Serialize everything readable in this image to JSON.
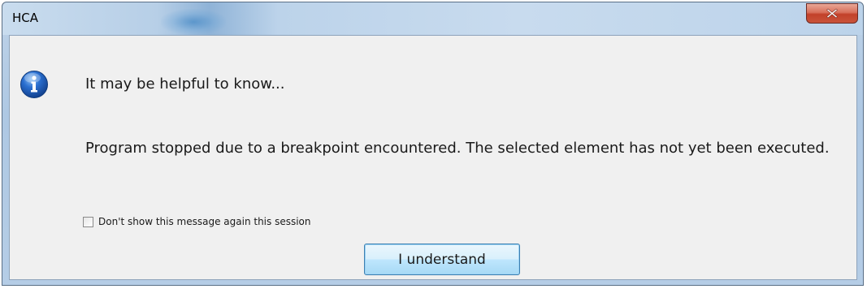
{
  "window": {
    "title": "HCA"
  },
  "dialog": {
    "headline": "It may be helpful to know...",
    "message": "Program stopped due to a breakpoint encountered. The selected element has not yet been executed.",
    "checkbox_label": "Don't show this message again this session",
    "checkbox_checked": false,
    "button_label": "I understand",
    "icon": "info-icon"
  },
  "colors": {
    "titlebar": "#bcd3ea",
    "close_button": "#c7513a",
    "client_background": "#f0f0f0",
    "button_border": "#3c7fb1"
  }
}
